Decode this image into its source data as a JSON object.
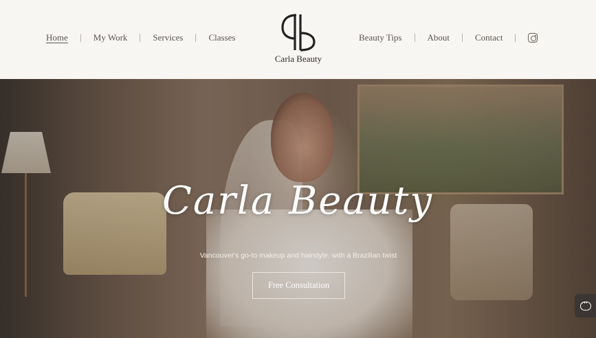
{
  "nav_left": [
    {
      "label": "Home",
      "active": true
    },
    {
      "label": "My Work"
    },
    {
      "label": "Services"
    },
    {
      "label": "Classes"
    }
  ],
  "nav_right": [
    {
      "label": "Beauty Tips"
    },
    {
      "label": "About"
    },
    {
      "label": "Contact"
    }
  ],
  "social": {
    "icon": "instagram-icon"
  },
  "logo": {
    "monogram": "CB",
    "text": "Carla Beauty"
  },
  "hero": {
    "title": "Carla Beauty",
    "tagline": "Vancouver's go-to makeup and hairstyle, with a Brazilian twist",
    "cta_label": "Free Consultation"
  },
  "chat": {
    "icon": "chat-icon"
  },
  "colors": {
    "header_bg": "#f8f6f3",
    "nav_text": "#5a5450",
    "hero_text": "#ffffff"
  }
}
